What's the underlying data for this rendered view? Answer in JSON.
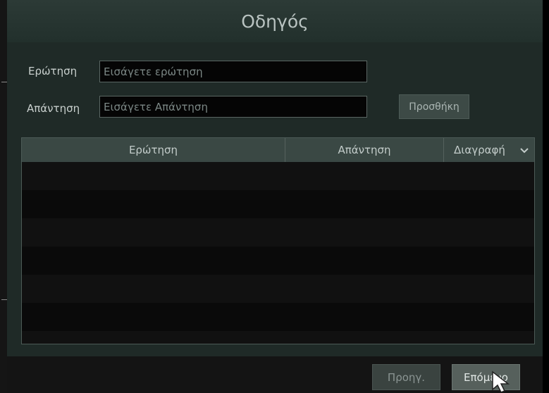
{
  "window": {
    "title": "Οδηγός"
  },
  "form": {
    "question_label": "Ερώτηση",
    "question_placeholder": "Εισάγετε ερώτηση",
    "question_value": "",
    "answer_label": "Απάντηση",
    "answer_placeholder": "Εισάγετε Απάντηση",
    "answer_value": "",
    "add_button": "Προσθήκη"
  },
  "table": {
    "columns": [
      "Ερώτηση",
      "Απάντηση",
      "Διαγραφή"
    ],
    "dropdown_icon": "chevron-down-icon",
    "rows": []
  },
  "footer": {
    "prev_button": "Προηγ.",
    "next_button": "Επόμενο"
  },
  "colors": {
    "background": "#1f2a27",
    "titlebar": "#2c3a36",
    "header": "#3a4844"
  }
}
